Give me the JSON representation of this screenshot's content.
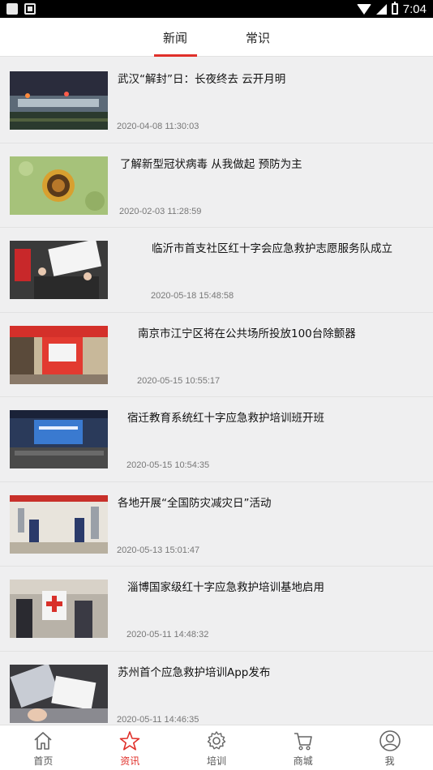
{
  "status_bar": {
    "time": "7:04"
  },
  "tabs": [
    {
      "label": "新闻",
      "active": true
    },
    {
      "label": "常识",
      "active": false
    }
  ],
  "accent_color": "#e0302a",
  "news": [
    {
      "title": "武汉“解封”日：长夜终去 云开月明",
      "date": "2020-04-08 11:30:03"
    },
    {
      "title": "了解新型冠状病毒 从我做起 预防为主",
      "date": "2020-02-03 11:28:59"
    },
    {
      "title": "临沂市首支社区红十字会应急救护志愿服务队成立",
      "date": "2020-05-18 15:48:58"
    },
    {
      "title": "南京市江宁区将在公共场所投放100台除颤器",
      "date": "2020-05-15 10:55:17"
    },
    {
      "title": "宿迁教育系统红十字应急救护培训班开班",
      "date": "2020-05-15 10:54:35"
    },
    {
      "title": "各地开展“全国防灾减灾日”活动",
      "date": "2020-05-13 15:01:47"
    },
    {
      "title": "淄博国家级红十字应急救护培训基地启用",
      "date": "2020-05-11 14:48:32"
    },
    {
      "title": "苏州首个应急救护培训App发布",
      "date": "2020-05-11 14:46:35"
    }
  ],
  "bottom_nav": [
    {
      "label": "首页",
      "icon": "home-icon",
      "active": false
    },
    {
      "label": "资讯",
      "icon": "star-icon",
      "active": true
    },
    {
      "label": "培训",
      "icon": "gear-icon",
      "active": false
    },
    {
      "label": "商城",
      "icon": "cart-icon",
      "active": false
    },
    {
      "label": "我",
      "icon": "user-icon",
      "active": false
    }
  ]
}
